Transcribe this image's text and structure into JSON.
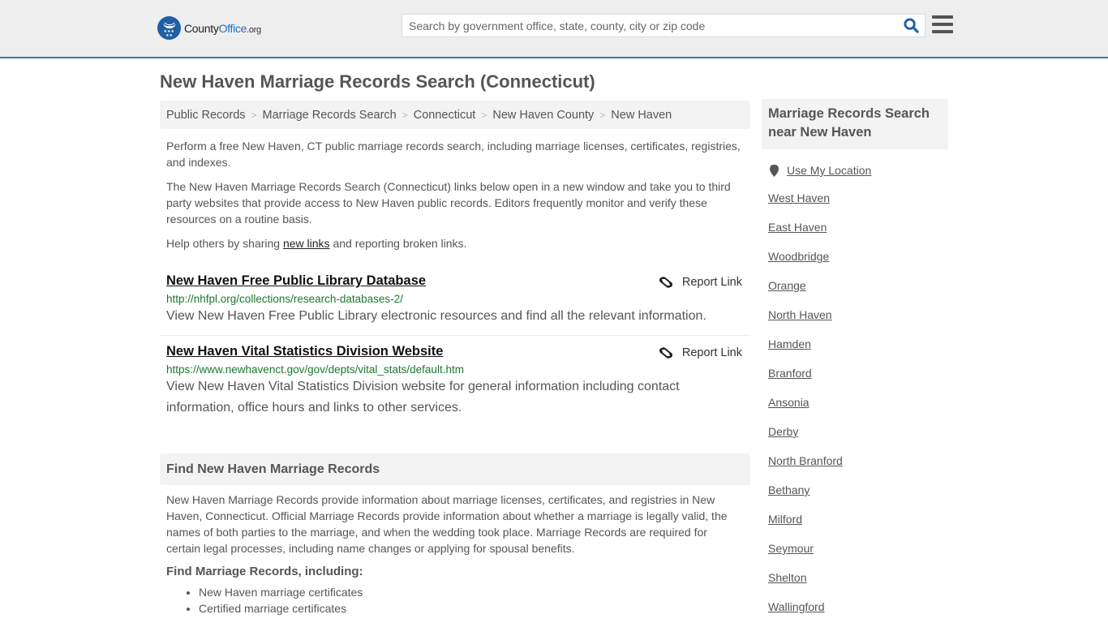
{
  "header": {
    "logo": {
      "name_part1": "County",
      "name_part2": "Office",
      "name_suffix": ".org"
    },
    "search": {
      "placeholder": "Search by government office, state, county, city or zip code",
      "value": ""
    },
    "brand_color": "#1e5fa3",
    "accent_border": "#3b78a8"
  },
  "page": {
    "title": "New Haven Marriage Records Search (Connecticut)"
  },
  "breadcrumb": [
    {
      "label": "Public Records"
    },
    {
      "label": "Marriage Records Search"
    },
    {
      "label": "Connecticut"
    },
    {
      "label": "New Haven County"
    },
    {
      "label": "New Haven"
    }
  ],
  "intro": {
    "p1": "Perform a free New Haven, CT public marriage records search, including marriage licenses, certificates, registries, and indexes.",
    "p2": "The New Haven Marriage Records Search (Connecticut) links below open in a new window and take you to third party websites that provide access to New Haven public records. Editors frequently monitor and verify these resources on a routine basis.",
    "p3_before": "Help others by sharing ",
    "p3_link": "new links",
    "p3_after": " and reporting broken links."
  },
  "links": [
    {
      "title": "New Haven Free Public Library Database",
      "url": "http://nhfpl.org/collections/research-databases-2/",
      "description": "View New Haven Free Public Library electronic resources and find all the relevant information.",
      "report_label": "Report Link"
    },
    {
      "title": "New Haven Vital Statistics Division Website",
      "url": "https://www.newhavenct.gov/gov/depts/vital_stats/default.htm",
      "description": "View New Haven Vital Statistics Division website for general information including contact information, office hours and links to other services.",
      "report_label": "Report Link"
    }
  ],
  "find_section": {
    "heading": "Find New Haven Marriage Records",
    "body": "New Haven Marriage Records provide information about marriage licenses, certificates, and registries in New Haven, Connecticut. Official Marriage Records provide information about whether a marriage is legally valid, the names of both parties to the marriage, and when the wedding took place. Marriage Records are required for certain legal processes, including name changes or applying for spousal benefits.",
    "subheading": "Find Marriage Records, including:",
    "bullets": [
      "New Haven marriage certificates",
      "Certified marriage certificates"
    ]
  },
  "sidebar": {
    "heading": "Marriage Records Search near New Haven",
    "use_location": "Use My Location",
    "places": [
      "West Haven",
      "East Haven",
      "Woodbridge",
      "Orange",
      "North Haven",
      "Hamden",
      "Branford",
      "Ansonia",
      "Derby",
      "North Branford",
      "Bethany",
      "Milford",
      "Seymour",
      "Shelton",
      "Wallingford"
    ]
  }
}
